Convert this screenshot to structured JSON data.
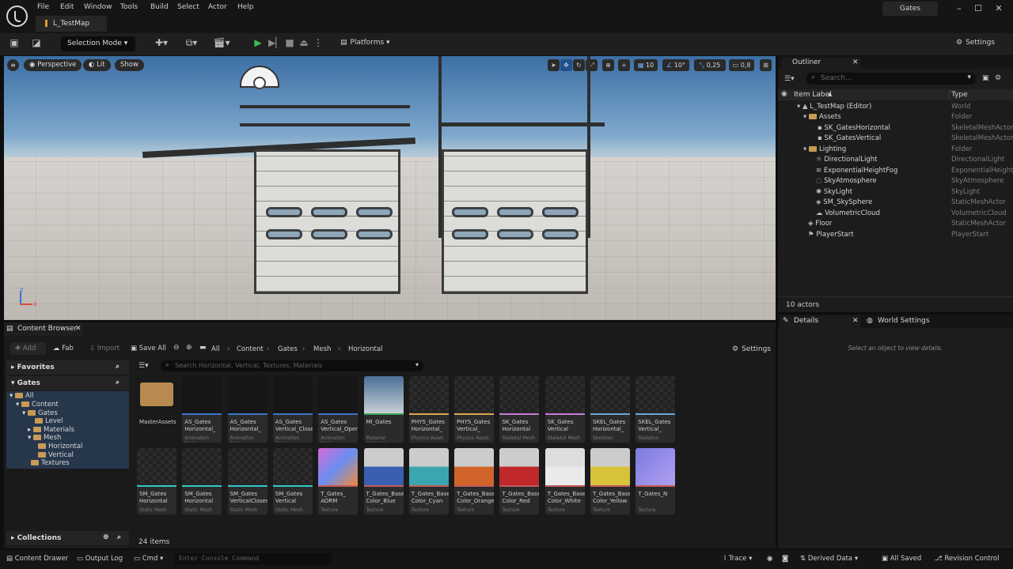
{
  "menu": [
    "File",
    "Edit",
    "Window",
    "Tools",
    "Build",
    "Select",
    "Actor",
    "Help"
  ],
  "map_tab": "L_TestMap",
  "project_name": "Gates",
  "toolbar": {
    "selection_mode": "Selection Mode",
    "platforms": "Platforms",
    "settings": "Settings"
  },
  "viewport": {
    "perspective": "Perspective",
    "lit": "Lit",
    "show": "Show",
    "grid_snap": "10",
    "rot_snap": "10°",
    "scale_snap": "0,25",
    "cam_speed": "0,8",
    "axis_z": "z",
    "axis_x": "x"
  },
  "outliner": {
    "title": "Outliner",
    "search_placeholder": "Search...",
    "col_label": "Item Label",
    "col_type": "Type",
    "items": [
      {
        "label": "L_TestMap (Editor)",
        "type": "World"
      },
      {
        "label": "Assets",
        "type": "Folder"
      },
      {
        "label": "SK_GatesHorizontal",
        "type": "SkeletalMeshActor"
      },
      {
        "label": "SK_GatesVertical",
        "type": "SkeletalMeshActor"
      },
      {
        "label": "Lighting",
        "type": "Folder"
      },
      {
        "label": "DirectionalLight",
        "type": "DirectionalLight"
      },
      {
        "label": "ExponentialHeightFog",
        "type": "ExponentialHeightF"
      },
      {
        "label": "SkyAtmosphere",
        "type": "SkyAtmosphere"
      },
      {
        "label": "SkyLight",
        "type": "SkyLight"
      },
      {
        "label": "SM_SkySphere",
        "type": "StaticMeshActor"
      },
      {
        "label": "VolumetricCloud",
        "type": "VolumetricCloud"
      },
      {
        "label": "Floor",
        "type": "StaticMeshActor"
      },
      {
        "label": "PlayerStart",
        "type": "PlayerStart"
      }
    ],
    "count": "10 actors"
  },
  "details": {
    "tab": "Details",
    "tab2": "World Settings",
    "empty": "Select an object to view details."
  },
  "content_browser": {
    "title": "Content Browser",
    "add": "Add",
    "fab": "Fab",
    "import": "Import",
    "save_all": "Save All",
    "settings": "Settings",
    "breadcrumbs": [
      "All",
      "Content",
      "Gates",
      "Mesh",
      "Horizontal"
    ],
    "search_placeholder": "Search Horizontal, Vertical, Textures, Materials",
    "favorites": "Favorites",
    "project": "Gates",
    "collections": "Collections",
    "tree": [
      "All",
      "Content",
      "Gates",
      "Level",
      "Materials",
      "Mesh",
      "Horizontal",
      "Vertical",
      "Textures"
    ],
    "items_count": "24 items",
    "assets": [
      {
        "name": "MasterAssets",
        "type": ""
      },
      {
        "name": "AS_Gates\nHorizontal_",
        "type": "Animation Sequ"
      },
      {
        "name": "AS_Gates\nHorizontal_",
        "type": "Animation Sequ"
      },
      {
        "name": "AS_Gates\nVertical_Close",
        "type": "Animation Sequ"
      },
      {
        "name": "AS_Gates\nVertical_Open",
        "type": "Animation Sequ"
      },
      {
        "name": "MI_Gates",
        "type": "Material Instance"
      },
      {
        "name": "PHYS_Gates\nHorizontal_",
        "type": "Physics Asset"
      },
      {
        "name": "PHYS_Gates\nVertical_",
        "type": "Physics Asset"
      },
      {
        "name": "SK_Gates\nHorizontal",
        "type": "Skeletal Mesh"
      },
      {
        "name": "SK_Gates\nVertical",
        "type": "Skeletal Mesh"
      },
      {
        "name": "SKEL_Gates\nHorizontal_",
        "type": "Skeleton"
      },
      {
        "name": "SKEL_Gates\nVertical_",
        "type": "Skeleton"
      },
      {
        "name": "SM_Gates\nHorizontal",
        "type": "Static Mesh"
      },
      {
        "name": "SM_Gates\nHorizontal",
        "type": "Static Mesh"
      },
      {
        "name": "SM_Gates\nVerticalClosed",
        "type": "Static Mesh"
      },
      {
        "name": "SM_Gates\nVertical",
        "type": "Static Mesh"
      },
      {
        "name": "T_Gates_\nAORM",
        "type": "Texture"
      },
      {
        "name": "T_Gates_Base\nColor_Blue",
        "type": "Texture"
      },
      {
        "name": "T_Gates_Base\nColor_Cyan",
        "type": "Texture"
      },
      {
        "name": "T_Gates_Base\nColor_Orange",
        "type": "Texture"
      },
      {
        "name": "T_Gates_Base\nColor_Red",
        "type": "Texture"
      },
      {
        "name": "T_Gates_Base\nColor_White",
        "type": "Texture"
      },
      {
        "name": "T_Gates_Base\nColor_Yellow",
        "type": "Texture"
      },
      {
        "name": "T_Gates_N",
        "type": "Texture"
      }
    ]
  },
  "statusbar": {
    "content_drawer": "Content Drawer",
    "output_log": "Output Log",
    "cmd": "Cmd",
    "console_placeholder": "Enter Console Command",
    "trace": "Trace",
    "derived_data": "Derived Data",
    "all_saved": "All Saved",
    "revision_control": "Revision Control"
  },
  "colors": {
    "accent": "#e69a2e",
    "play": "#3fb950",
    "selection": "#2d4563"
  }
}
